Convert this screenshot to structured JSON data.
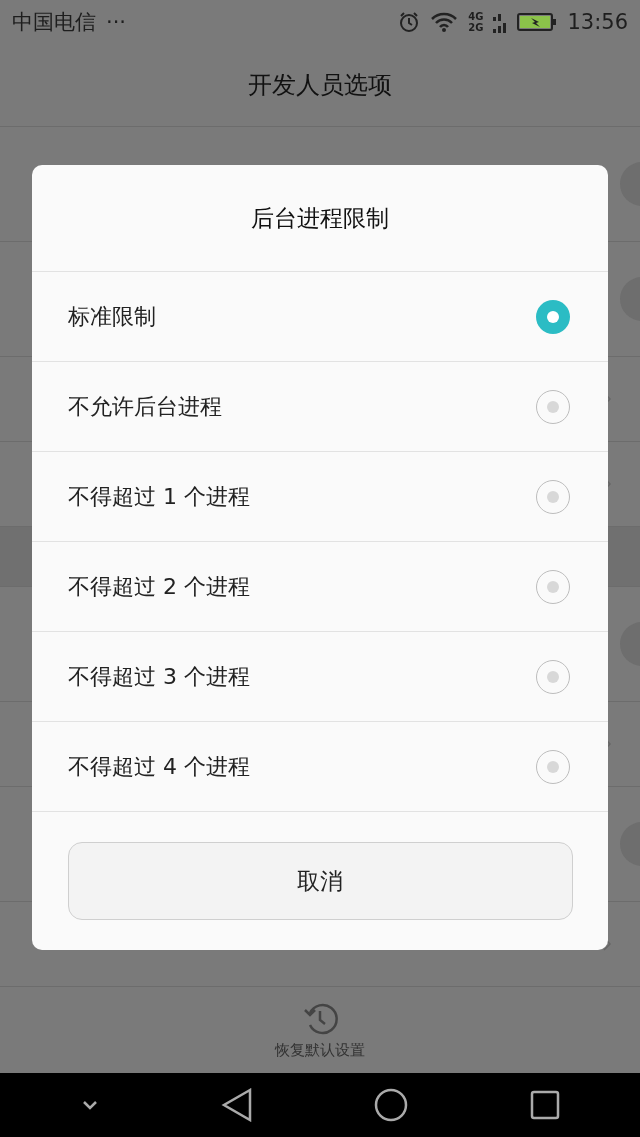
{
  "status_bar": {
    "carrier": "中国电信",
    "more": "···",
    "network_top": "4G",
    "network_bottom": "2G",
    "time": "13:56"
  },
  "header": {
    "title": "开发人员选项"
  },
  "background_rows": [
    {
      "kind": "toggle"
    },
    {
      "kind": "toggle"
    },
    {
      "kind": "chevron"
    },
    {
      "kind": "chevron"
    },
    {
      "kind": "gap"
    },
    {
      "kind": "toggle"
    },
    {
      "kind": "chevron"
    },
    {
      "kind": "toggle"
    },
    {
      "kind": "chevron"
    }
  ],
  "dialog": {
    "title": "后台进程限制",
    "options": [
      {
        "label": "标准限制",
        "selected": true
      },
      {
        "label": "不允许后台进程",
        "selected": false
      },
      {
        "label": "不得超过 1 个进程",
        "selected": false
      },
      {
        "label": "不得超过 2 个进程",
        "selected": false
      },
      {
        "label": "不得超过 3 个进程",
        "selected": false
      },
      {
        "label": "不得超过 4 个进程",
        "selected": false
      }
    ],
    "cancel": "取消"
  },
  "footer": {
    "restore_label": "恢复默认设置"
  }
}
